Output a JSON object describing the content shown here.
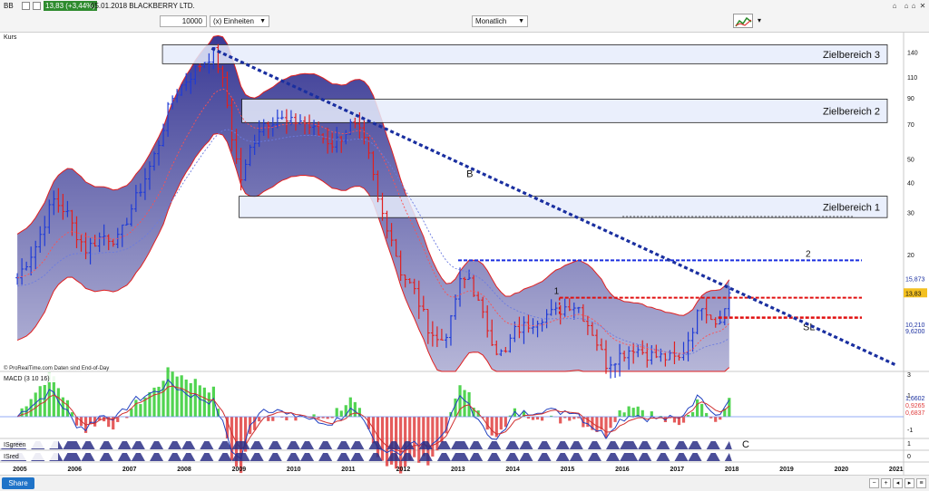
{
  "toolbar": {
    "ticker": "BB",
    "price_badge": "13,83 (+3,44%)",
    "date_title": "05.01.2018 BLACKBERRY LTD.",
    "quantity": "10000",
    "units": "(x) Einheiten",
    "period": "Monatlich",
    "window_controls": [
      "⌂",
      "⌂",
      "⌂",
      "✕"
    ]
  },
  "panels": {
    "kurs": "Kurs",
    "macd": "MACD (3 10 16)",
    "isgreen": "ISgreen",
    "isred": "ISred"
  },
  "watermark": "© ProRealTime.com  Daten sind End-of-Day",
  "annotations": {
    "z3": "Zielbereich 3",
    "z2": "Zielbereich 2",
    "z1": "Zielbereich 1",
    "B": "B",
    "one": "1",
    "two": "2",
    "SL": "SL",
    "C": "C"
  },
  "price_tags": {
    "blue_top": "15,873",
    "current": "13,83",
    "blue_mid": "10,210",
    "blue_low": "9,6200"
  },
  "macd_tags": {
    "top": "1,6602",
    "mid": "0,9265",
    "low": "0,6837"
  },
  "bottom_bar": {
    "share": "Share"
  },
  "colors": {
    "band_fill": "#4a4aa0",
    "red_line": "#e02020",
    "blue_dot": "#1a2fa0",
    "green": "#33cc33",
    "up_bar": "#1f3bd6",
    "down_bar": "#e02020"
  },
  "chart_data": {
    "type": "candlestick",
    "scale": "log",
    "frequency": "monthly",
    "x_ticks": [
      "2005",
      "2006",
      "2007",
      "2008",
      "2009",
      "2010",
      "2011",
      "2012",
      "2013",
      "2014",
      "2015",
      "2016",
      "2017",
      "2018",
      "2019",
      "2020",
      "2021"
    ],
    "y_ticks": [
      "140",
      "110",
      "90",
      "70",
      "50",
      "40",
      "30",
      "20"
    ],
    "macd_ticks": [
      "3",
      "1",
      "-1"
    ],
    "isgreen_ticks": [
      "1",
      "0"
    ],
    "isred_ticks": [
      "1",
      "0"
    ],
    "yrange": [
      6.5,
      160
    ],
    "target_zones": [
      {
        "label": "Zielbereich 3",
        "low": 125,
        "high": 150
      },
      {
        "label": "Zielbereich 2",
        "low": 71,
        "high": 89
      },
      {
        "label": "Zielbereich 1",
        "low": 28.5,
        "high": 35
      }
    ],
    "levels": [
      {
        "name": "2",
        "value": 18.9,
        "color": "blue"
      },
      {
        "name": "1",
        "value": 13.2,
        "color": "red"
      },
      {
        "name": "SL",
        "value": 10.9,
        "color": "red"
      }
    ],
    "trendline_B": [
      {
        "x": 2008.5,
        "y": 145
      },
      {
        "x": 2021.0,
        "y": 6.9
      }
    ],
    "last_close": 13.83,
    "path": [
      [
        2004.95,
        16
      ],
      [
        2005.3,
        22
      ],
      [
        2005.6,
        34
      ],
      [
        2005.85,
        30
      ],
      [
        2006.0,
        25
      ],
      [
        2006.2,
        21
      ],
      [
        2006.5,
        24
      ],
      [
        2006.8,
        23
      ],
      [
        2007.0,
        30
      ],
      [
        2007.25,
        40
      ],
      [
        2007.5,
        55
      ],
      [
        2007.75,
        88
      ],
      [
        2008.0,
        105
      ],
      [
        2008.3,
        125
      ],
      [
        2008.55,
        140
      ],
      [
        2008.75,
        95
      ],
      [
        2008.9,
        55
      ],
      [
        2009.05,
        40
      ],
      [
        2009.2,
        55
      ],
      [
        2009.4,
        70
      ],
      [
        2009.7,
        75
      ],
      [
        2009.9,
        70
      ],
      [
        2010.1,
        73
      ],
      [
        2010.3,
        68
      ],
      [
        2010.5,
        62
      ],
      [
        2010.7,
        58
      ],
      [
        2010.9,
        63
      ],
      [
        2011.05,
        70
      ],
      [
        2011.25,
        62
      ],
      [
        2011.4,
        48
      ],
      [
        2011.55,
        32
      ],
      [
        2011.75,
        25
      ],
      [
        2011.95,
        17
      ],
      [
        2012.2,
        14
      ],
      [
        2012.45,
        10
      ],
      [
        2012.65,
        8.5
      ],
      [
        2012.85,
        10
      ],
      [
        2013.0,
        15
      ],
      [
        2013.2,
        16
      ],
      [
        2013.45,
        11
      ],
      [
        2013.7,
        8.0
      ],
      [
        2013.85,
        7.5
      ],
      [
        2014.0,
        9.5
      ],
      [
        2014.2,
        10
      ],
      [
        2014.5,
        11
      ],
      [
        2014.8,
        11.5
      ],
      [
        2015.05,
        12.5
      ],
      [
        2015.2,
        12
      ],
      [
        2015.45,
        9.5
      ],
      [
        2015.7,
        7.0
      ],
      [
        2015.9,
        7.5
      ],
      [
        2016.2,
        8.2
      ],
      [
        2016.5,
        7.6
      ],
      [
        2016.8,
        7.4
      ],
      [
        2017.05,
        7.3
      ],
      [
        2017.25,
        9.5
      ],
      [
        2017.45,
        12.5
      ],
      [
        2017.7,
        10.5
      ],
      [
        2017.85,
        11.5
      ],
      [
        2018.0,
        13.83
      ]
    ]
  }
}
